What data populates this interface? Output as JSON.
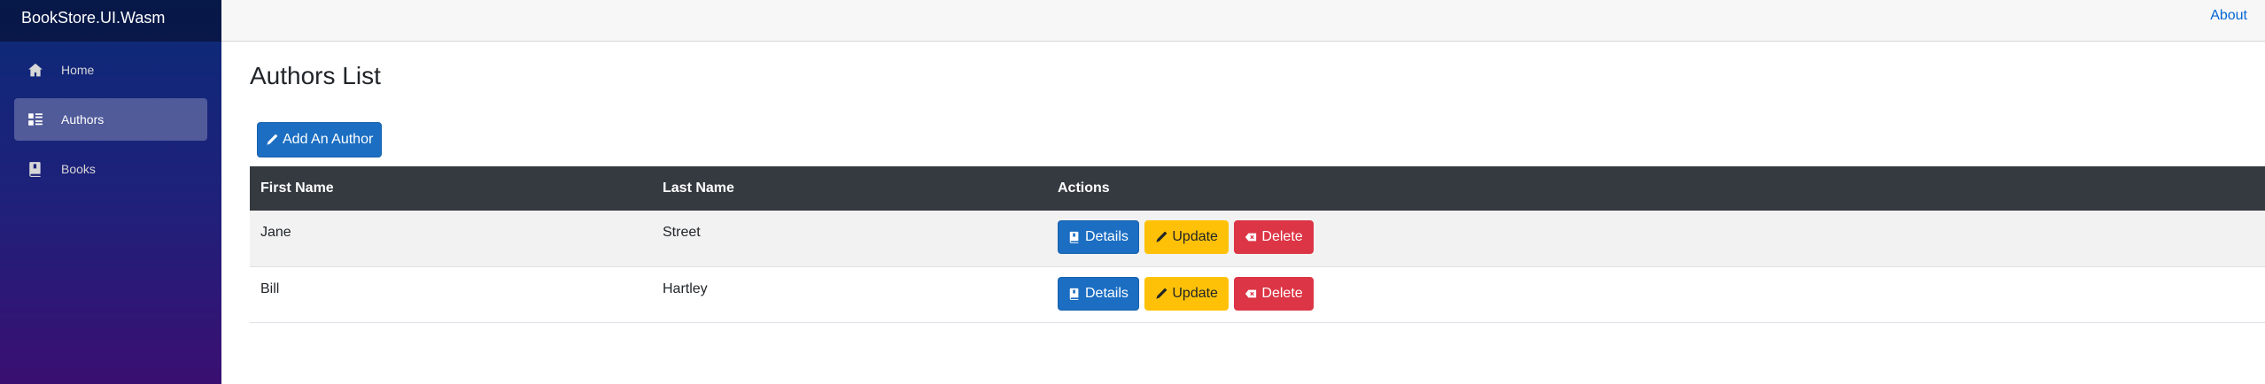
{
  "app": {
    "brand": "BookStore.UI.Wasm"
  },
  "sidebar": {
    "items": [
      {
        "label": "Home",
        "icon": "home-icon",
        "active": false
      },
      {
        "label": "Authors",
        "icon": "list-icon",
        "active": true
      },
      {
        "label": "Books",
        "icon": "book-icon",
        "active": false
      }
    ]
  },
  "topbar": {
    "about_label": "About"
  },
  "page": {
    "title": "Authors List",
    "add_button_label": "Add An Author"
  },
  "table": {
    "headers": [
      "First Name",
      "Last Name",
      "Actions"
    ],
    "rows": [
      {
        "first_name": "Jane",
        "last_name": "Street"
      },
      {
        "first_name": "Bill",
        "last_name": "Hartley"
      }
    ],
    "actions": {
      "details": "Details",
      "update": "Update",
      "delete": "Delete"
    }
  },
  "colors": {
    "primary": "#1b6ec2",
    "warning": "#ffc107",
    "danger": "#dc3545",
    "table_header": "#343a40"
  }
}
